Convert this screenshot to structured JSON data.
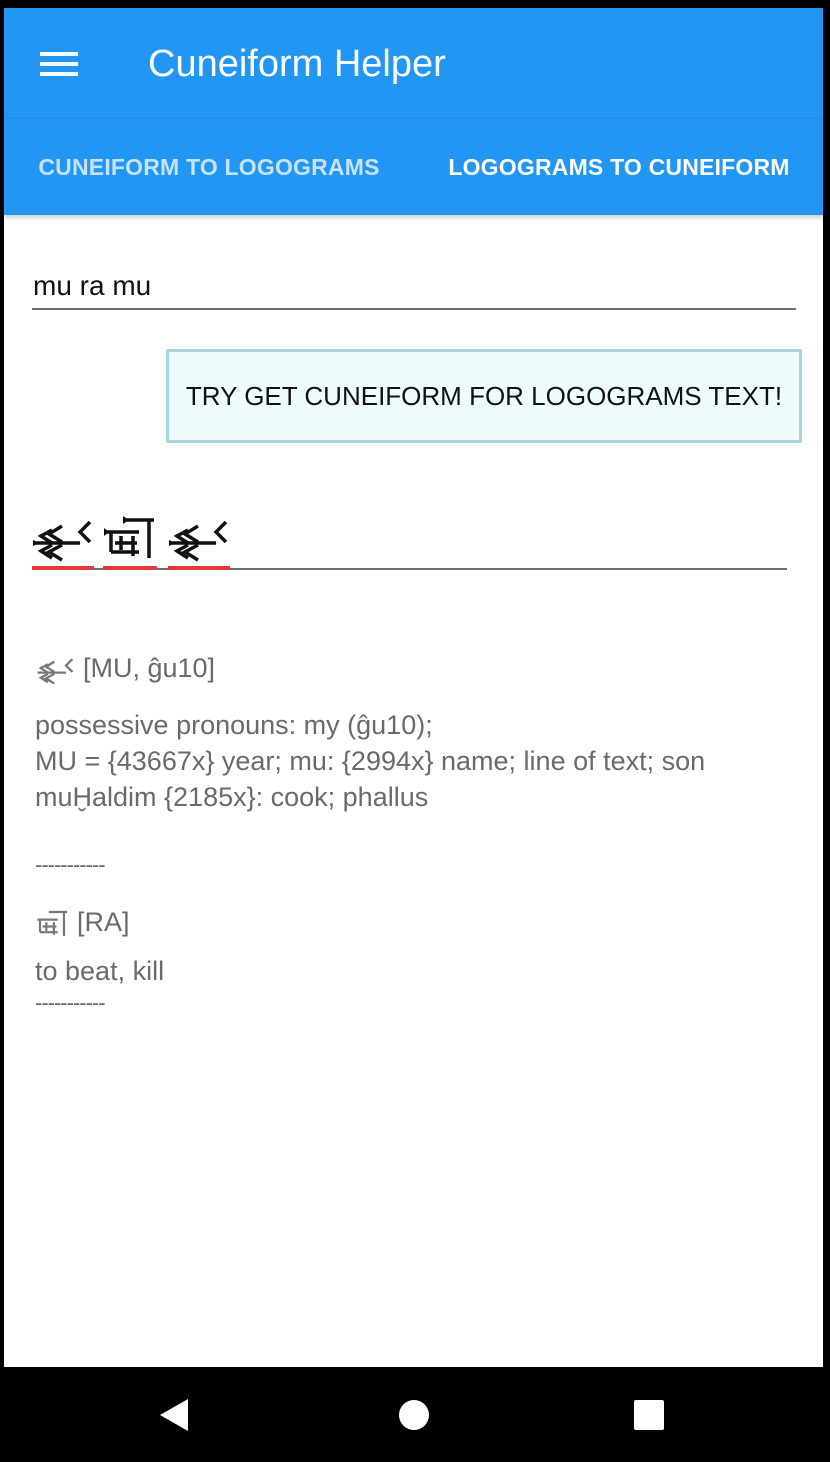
{
  "app": {
    "title": "Cuneiform Helper"
  },
  "tabs": [
    {
      "label": "CUNEIFORM TO LOGOGRAMS",
      "active": false
    },
    {
      "label": "LOGOGRAMS TO CUNEIFORM",
      "active": true
    }
  ],
  "input": {
    "value": "mu ra mu"
  },
  "action_button": {
    "label": "TRY GET CUNEIFORM FOR LOGOGRAMS TEXT!"
  },
  "result": {
    "glyphs": [
      "mu-sign",
      "ra-sign",
      "mu-sign"
    ]
  },
  "entries": [
    {
      "sign": "mu-sign",
      "heading": "[MU, ĝu10]",
      "lines": [
        "possessive pronouns: my  (ĝu10);",
        "MU = {43667x} year; mu: {2994x} name; line of text; son",
        "muḪaldim {2185x}: cook; phallus"
      ]
    },
    {
      "sign": "ra-sign",
      "heading": "[RA]",
      "lines": [
        "to beat, kill"
      ]
    }
  ],
  "divider": "-----------",
  "colors": {
    "primary": "#2196f3",
    "tab_inactive_text": "#c6e2fb",
    "button_bg": "#eefcfd",
    "button_border": "#a8d5e2",
    "spell_underline": "#e53935",
    "entry_text": "#6a6a6a"
  },
  "icons": {
    "menu": "hamburger-menu-icon",
    "nav_back": "triangle-back-icon",
    "nav_home": "circle-home-icon",
    "nav_recents": "square-recents-icon"
  }
}
